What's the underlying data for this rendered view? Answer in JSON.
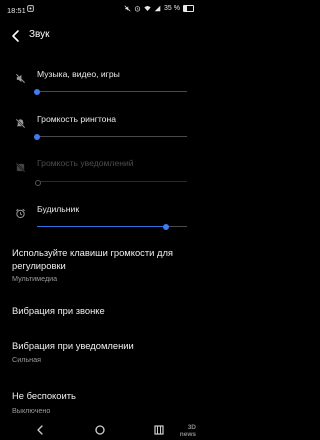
{
  "status_bar": {
    "time": "18:51",
    "battery_text": "35 %",
    "battery_level": 0.35,
    "icons": [
      "notification-icon",
      "mute-icon",
      "alarm-icon",
      "wifi-icon",
      "signal-icon",
      "battery-icon"
    ]
  },
  "header": {
    "title": "Звук"
  },
  "sliders": [
    {
      "label": "Музыка, видео, игры",
      "icon": "speaker-muted-icon",
      "level": 0.0,
      "enabled": true
    },
    {
      "label": "Громкость рингтона",
      "icon": "bell-muted-icon",
      "level": 0.0,
      "enabled": true
    },
    {
      "label": "Громкость уведомлений",
      "icon": "notification-muted-icon",
      "level": 0.0,
      "enabled": false
    },
    {
      "label": "Будильник",
      "icon": "alarm-clock-icon",
      "level": 0.86,
      "enabled": true
    }
  ],
  "settings": [
    {
      "title": "Используйте клавиши громкости для регулировки",
      "subtitle": "Мультимедиа"
    },
    {
      "title": "Вибрация при звонке",
      "subtitle": ""
    },
    {
      "title": "Вибрация при уведомлении",
      "subtitle": "Сильная"
    },
    {
      "title": "Не беспокоить",
      "subtitle": "Выключено"
    }
  ],
  "nav_bar": {
    "icons": [
      "back-icon",
      "home-icon",
      "recents-icon"
    ]
  },
  "watermark": {
    "line1": "3D",
    "line2": "news"
  },
  "colors": {
    "background": "#000000",
    "accent": "#3d7df0",
    "text": "#f1f1f1",
    "secondary_text": "#9a9a9a"
  }
}
